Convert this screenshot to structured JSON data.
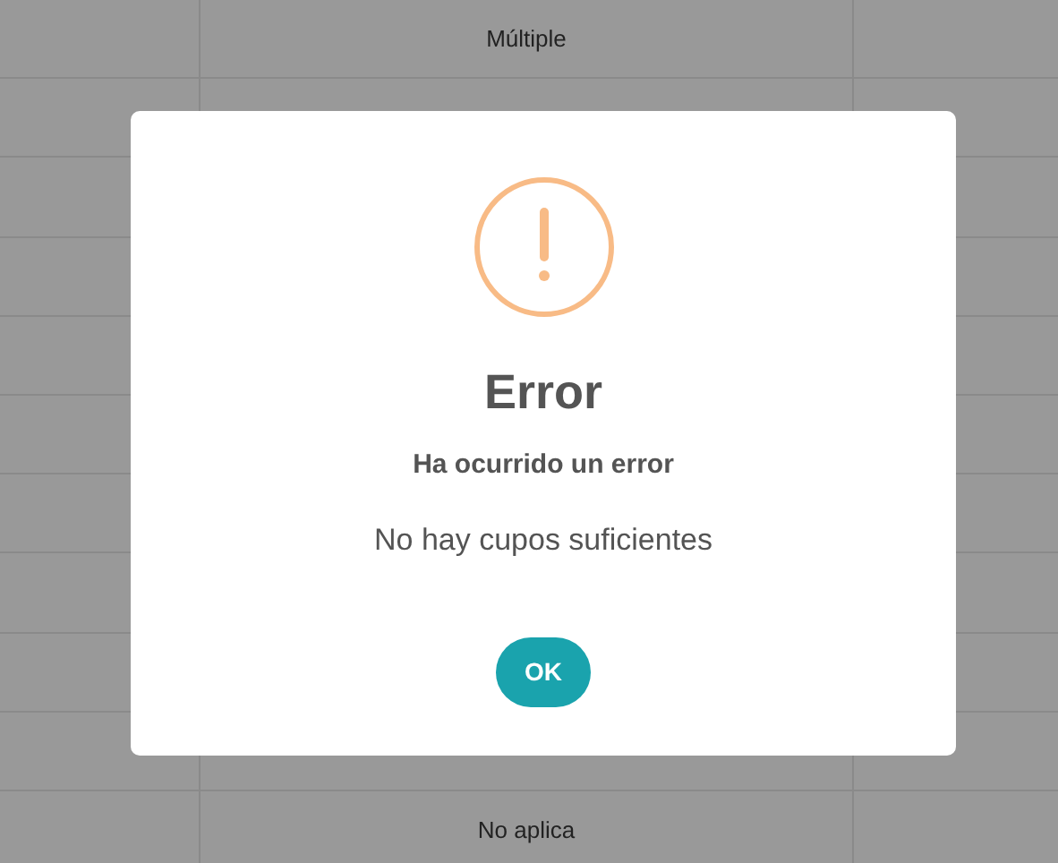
{
  "table": {
    "rows": [
      {
        "column_2": "Múltiple"
      },
      {},
      {},
      {},
      {},
      {},
      {},
      {},
      {},
      {},
      {
        "column_2": "No aplica"
      }
    ]
  },
  "dialog": {
    "title": "Error",
    "subtitle": "Ha ocurrido un error",
    "message": "No hay cupos suficientes",
    "buttons": [
      "OK"
    ]
  }
}
